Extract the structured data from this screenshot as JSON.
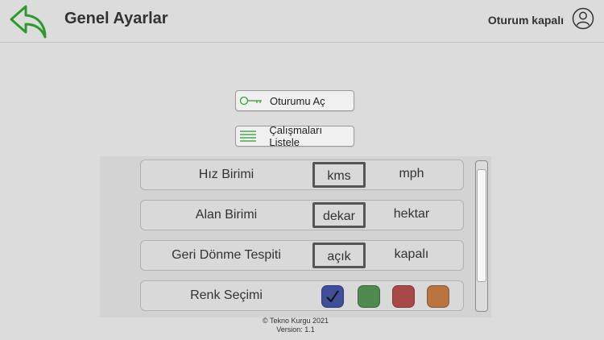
{
  "header": {
    "title": "Genel Ayarlar",
    "session_status": "Oturum kapalı",
    "back_icon": "back-arrow-icon",
    "user_icon": "user-icon",
    "accent_color": "#2e9a2e"
  },
  "actions": {
    "open_session_label": "Oturumu Aç",
    "open_session_icon": "key-icon",
    "list_works_label": "Çalışmaları Listele",
    "list_works_icon": "list-icon"
  },
  "settings": {
    "speed": {
      "label": "Hız Birimi",
      "options": [
        "kms",
        "mph"
      ],
      "selected": "kms"
    },
    "area": {
      "label": "Alan Birimi",
      "options": [
        "dekar",
        "hektar"
      ],
      "selected": "dekar"
    },
    "reverse": {
      "label": "Geri Dönme Tespiti",
      "options": [
        "açık",
        "kapalı"
      ],
      "selected": "açık"
    },
    "color": {
      "label": "Renk Seçimi",
      "swatches": [
        "#3f4f9a",
        "#4e8a4e",
        "#a84848",
        "#b87540"
      ],
      "selected_index": 0
    }
  },
  "footer": {
    "copyright": "© Tekno Kurgu 2021",
    "version": "Version: 1.1"
  }
}
